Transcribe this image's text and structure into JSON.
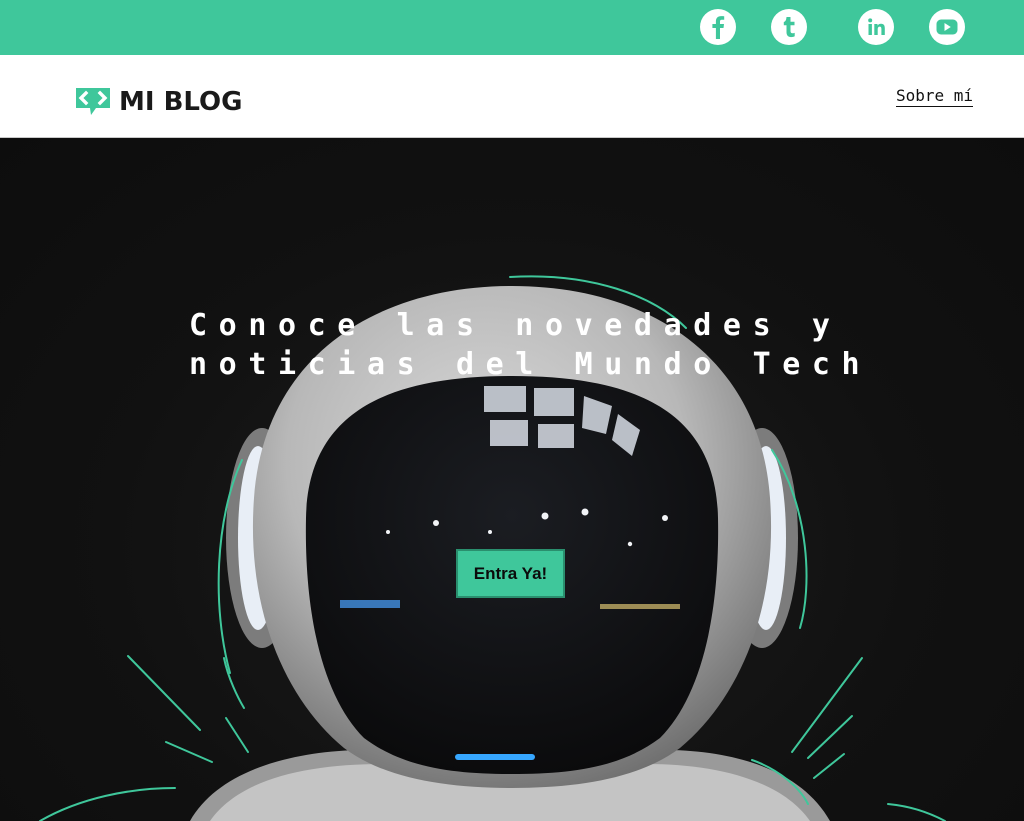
{
  "brand": {
    "name": "MI BLOG",
    "accent_color": "#3fc79b"
  },
  "social": [
    {
      "name": "facebook-icon"
    },
    {
      "name": "tumblr-icon"
    },
    {
      "name": "linkedin-icon"
    },
    {
      "name": "youtube-icon"
    }
  ],
  "nav": {
    "about_label": "Sobre mí"
  },
  "hero": {
    "headline": "Conoce las novedades y\nnoticias del Mundo Tech",
    "cta_label": "Entra Ya!"
  }
}
